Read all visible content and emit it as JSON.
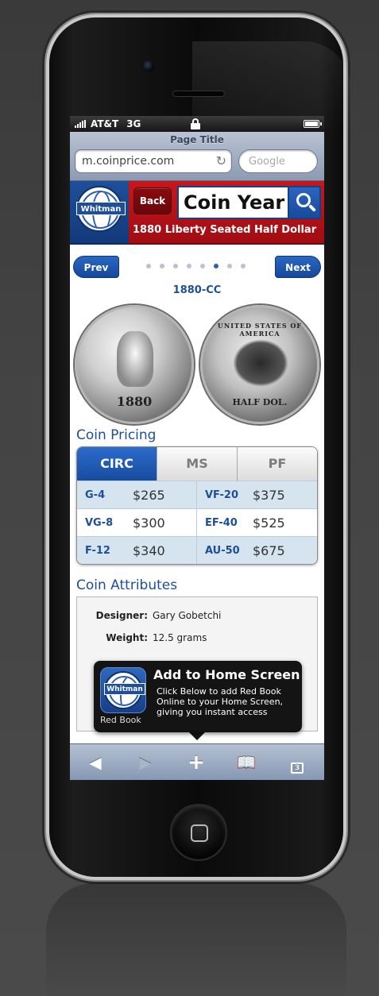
{
  "status": {
    "carrier": "AT&T",
    "network": "3G"
  },
  "browser": {
    "page_title": "Page Title",
    "url": "m.coinprice.com",
    "search_placeholder": "Google"
  },
  "header": {
    "logo_text": "Whitman",
    "back_label": "Back",
    "search_value": "Coin Year",
    "coin_title": "1880 Liberty Seated Half Dollar"
  },
  "navigation": {
    "prev_label": "Prev",
    "next_label": "Next",
    "dots_total": 8,
    "dot_active_index": 5
  },
  "coin": {
    "label": "1880-CC",
    "obverse_year": "1880",
    "reverse_text": "UNITED STATES OF AMERICA",
    "reverse_denomination": "HALF DOL."
  },
  "pricing": {
    "section_title": "Coin Pricing",
    "tabs": [
      {
        "label": "CIRC",
        "active": true
      },
      {
        "label": "MS",
        "active": false
      },
      {
        "label": "PF",
        "active": false
      }
    ],
    "rows": [
      {
        "left_grade": "G-4",
        "left_price": "$265",
        "right_grade": "VF-20",
        "right_price": "$375"
      },
      {
        "left_grade": "VG-8",
        "left_price": "$300",
        "right_grade": "EF-40",
        "right_price": "$525"
      },
      {
        "left_grade": "F-12",
        "left_price": "$340",
        "right_grade": "AU-50",
        "right_price": "$675"
      }
    ]
  },
  "attributes": {
    "section_title": "Coin Attributes",
    "items": [
      {
        "label": "Designer:",
        "value": "Gary Gobetchi"
      },
      {
        "label": "Weight:",
        "value": "12.5 grams"
      }
    ]
  },
  "popup": {
    "title": "Add to Home Screen",
    "text": "Click Below to add Red Book Online to your Home Screen, giving you instant access",
    "app_name": "Red Book",
    "icon_text": "Whitman"
  },
  "toolbar": {
    "tab_count": "3"
  },
  "colors": {
    "brand_blue": "#1f4f9a",
    "brand_red": "#c8161d"
  }
}
